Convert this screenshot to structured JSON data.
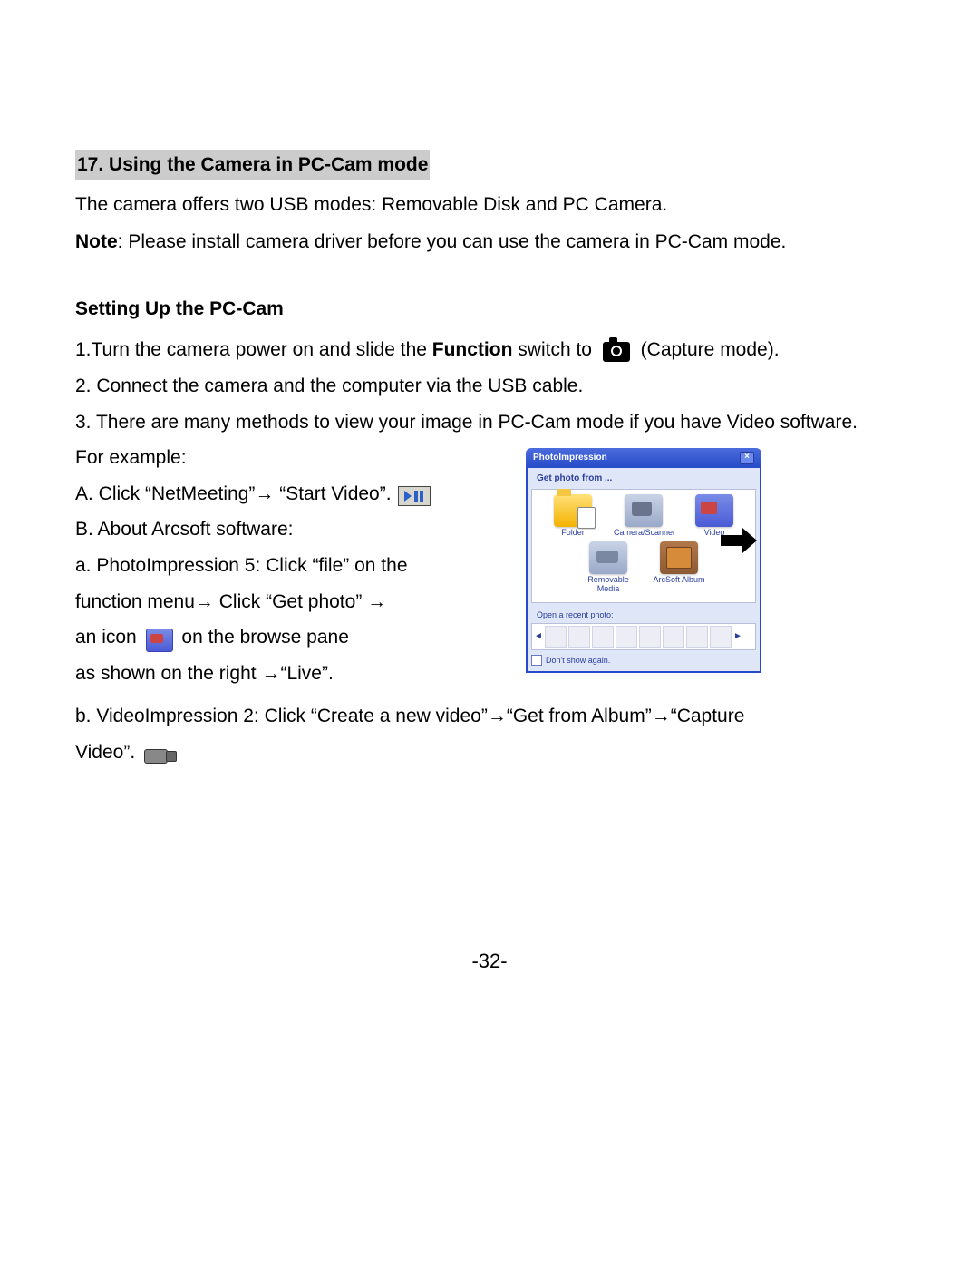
{
  "section_heading": "17. Using the Camera in PC-Cam mode",
  "intro": "The camera offers two USB modes: Removable Disk and PC Camera.",
  "note_label": "Note",
  "note_text": ": Please install camera driver before you can use the camera in PC-Cam mode.",
  "sub_heading": "Setting Up the PC-Cam",
  "step1_pre": "1.Turn the camera power on and slide the ",
  "step1_bold": "Function",
  "step1_mid": " switch to",
  "step1_post": " (Capture mode).",
  "step2": "2. Connect the camera and the computer via the USB cable.",
  "step3": "3. There are many methods to view your image in PC-Cam mode if you have Video software.",
  "step3_eg": "For example:",
  "A_line_pre": "A. Click “NetMeeting”",
  "A_line_arrow1": "→",
  "A_line_post": " “Start Video”.",
  "B_line": "B. About Arcsoft software:",
  "a1": "a.   PhotoImpression 5: Click “file” on the",
  "a2_pre": "function menu",
  "a2_arrow": "→",
  "a2_mid": " Click “Get photo” ",
  "a2_arrow2": "→",
  "a3_pre": "an icon",
  "a3_post": " on the browse pane",
  "a4_pre": "as shown on the right ",
  "a4_arrow": "→",
  "a4_post": "“Live”.",
  "b1_pre": "b.    VideoImpression 2: Click “Create a new video”",
  "b1_arrow1": "→",
  "b1_mid": "“Get from Album”",
  "b1_arrow2": "→",
  "b1_post": "“Capture",
  "b2_pre": "Video”.",
  "popup": {
    "title": "PhotoImpression",
    "subtitle": "Get photo from ...",
    "icons": [
      {
        "label": "Folder"
      },
      {
        "label": "Camera/Scanner"
      },
      {
        "label": "Video"
      },
      {
        "label": "Removable Media"
      },
      {
        "label": "ArcSoft Album"
      }
    ],
    "recent": "Open a recent photo:",
    "dontshow": "Don't show again."
  },
  "page_number": "-32-"
}
